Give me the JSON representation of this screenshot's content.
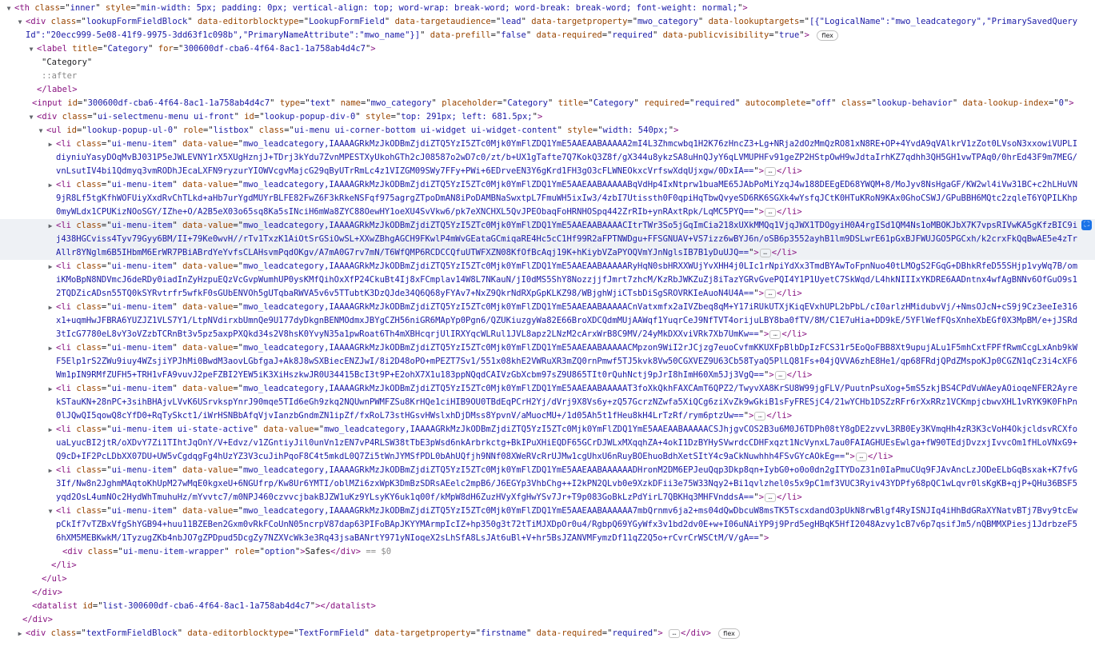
{
  "th_line": {
    "tag": "th",
    "attrs": [
      {
        "name": "class",
        "value": "inner"
      },
      {
        "name": "style",
        "value": "min-width: 5px; padding: 0px; vertical-align: top; word-wrap: break-word; word-break: break-word; font-weight: normal;"
      }
    ]
  },
  "lookup_block": {
    "tag": "div",
    "attrs": [
      {
        "name": "class",
        "value": "lookupFormFieldBlock"
      },
      {
        "name": "data-editorblocktype",
        "value": "LookupFormField"
      },
      {
        "name": "data-targetaudience",
        "value": "lead"
      },
      {
        "name": "data-targetproperty",
        "value": "mwo_category"
      },
      {
        "name": "data-lookuptargets",
        "value": "[{\"LogicalName\":\"mwo_leadcategory\",\"PrimarySavedQueryId\":\"20ecc999-5e08-41f9-9975-3dd63f1c098b\",\"PrimaryNameAttribute\":\"mwo_name\"}]"
      },
      {
        "name": "data-prefill",
        "value": "false"
      },
      {
        "name": "data-required",
        "value": "required"
      },
      {
        "name": "data-publicvisibility",
        "value": "true"
      }
    ],
    "badge": "flex"
  },
  "label_open": {
    "tag": "label",
    "attrs": [
      {
        "name": "title",
        "value": "Category"
      },
      {
        "name": "for",
        "value": "300600df-cba6-4f64-8ac1-1a758ab4d4c7"
      }
    ]
  },
  "label_text": "\"Category\"",
  "label_after": "::after",
  "label_close": "label",
  "input_line": {
    "tag": "input",
    "attrs": [
      {
        "name": "id",
        "value": "300600df-cba6-4f64-8ac1-1a758ab4d4c7"
      },
      {
        "name": "type",
        "value": "text"
      },
      {
        "name": "name",
        "value": "mwo_category"
      },
      {
        "name": "placeholder",
        "value": "Category"
      },
      {
        "name": "title",
        "value": "Category"
      },
      {
        "name": "required",
        "value": "required"
      },
      {
        "name": "autocomplete",
        "value": "off"
      },
      {
        "name": "class",
        "value": "lookup-behavior"
      },
      {
        "name": "data-lookup-index",
        "value": "0"
      }
    ]
  },
  "popup_div": {
    "tag": "div",
    "attrs": [
      {
        "name": "class",
        "value": "ui-selectmenu-menu ui-front"
      },
      {
        "name": "id",
        "value": "lookup-popup-div-0"
      },
      {
        "name": "style",
        "value": "top: 291px; left: 681.5px;"
      }
    ]
  },
  "ul_line": {
    "tag": "ul",
    "attrs": [
      {
        "name": "id",
        "value": "lookup-popup-ul-0"
      },
      {
        "name": "role",
        "value": "listbox"
      },
      {
        "name": "class",
        "value": "ui-menu ui-corner-bottom ui-widget ui-widget-content"
      },
      {
        "name": "style",
        "value": "width: 540px;"
      }
    ]
  },
  "items": [
    {
      "class": "ui-menu-item",
      "value": "mwo_leadcategory,IAAAAGRkMzJkODBmZjdiZTQ5YzI5ZTc0Mjk0YmFlZDQ1YmE5AAEAABAAAAA2mI4L3Zhmcwbq1H2K76zHncZ3+Lg+NRja2dOzMmQzRO81xN8RE+OP+4YvdA9qVAlkrV1zZot0LVsoN3xxowiVUPLIdiyniuYasyDOqMvBJ031P5eJWLEVNY1rX5XUgHznjJ+TDrj3kYdu7ZvnMPESTXyUkohGTh2cJ08587o2wD7c0/zt/b+UX1gTafte7Q7KokQ3Z8f/gX344u8ykzSA8uHnQJyY6qLVMUPHFv91geZP2HStpOwH9wJdtaIrhKZ7qdhh3QH5GH1vwTPAq0/0hrEd43F9m7MEG/vnLsutIV4bi1Qdmyq3vmRODhJEcaLXFN9ryzurYIOWVcgvMajcG29qByUTrRmLc4z1VIZGM09SWy7FFy+PWi+6EDrveEN3Y6gKrd1FH3gO3cFLWNEOkxcVrfswXdqUjxgw/0DxIA=="
    },
    {
      "class": "ui-menu-item",
      "value": "mwo_leadcategory,IAAAAGRkMzJkODBmZjdiZTQ5YzI5ZTc0Mjk0YmFlZDQ1YmE5AAEAABAAAAABqVdHp4IxNtprw1buaME65JAbPoMiYzqJ4w188DEEgED68YWQM+8/MoJyv8NsHgaGF/KW2wl4iVw31BC+c2hLHuVN9jR8Lf5tgKfhWOFUiyXxdRvChTLkd+aHb7urYgdMUYrBLFE82FwZ6F3kRkeNSFqf975agrgZTpoDmAN8iPoDAMBNaSwxtpL7FmuWH5ixIw3/4zbI7Utissth0F0qpiHqTbwQvyeSD6RK6SGXk4wYsfqJCtK0HTuKRoN9KAx0GhoCSWJ/GPuBBH6MQtc2zqleT6YQPILKhp0myWLdx1CPUKizNOoSGY/IZhe+O/A2B5eX03o65sq8Ka5sINciH6mWa8ZYC88OewHY1oeXU4SvVkw6/pk7eXNCHXL5QvJPEObaqFoHRNHOSpq442ZrRIb+ynRAxtRpk/LqMC5PYQ=="
    },
    {
      "class": "ui-menu-item",
      "value": "mwo_leadcategory,IAAAAGRkMzJkODBmZjdiZTQ5YzI5ZTc0Mjk0YmFlZDQ1YmE5AAEAABAAAACItrTWr3So5jGqImCia218xUXkMMQq1VjqJWX1TDOgyiH0A4rgISd1QM4Ns1oMBOKJbX7K7vpsRIVwKA5gKfzBIC9ij438HGCviss4Tyv79Gyy6BM/II+79Ke0wvH//rTv1TxzK1AiOtSrGSiOwSL+XXwZBhgAGCH9FKwlP4mWvGEataGCmiqaRE4Hc5cC1Hf99R2aFPTNWDgu+FFSGNUAV+VS7izz6wBYJ6n/oSB6p3552ayhB1lm9DSLwrE61pGxBJFWUJGO5PGCxh/k2crxFkQqBwAE5e4zTrAllr8YNglm6B5IHbmM6ErWR7PBiABrdYeYvfsCLAHsvmPqdOKgv/A7mA0G7rv7mN/T6WfQMP6RCDCCQfuUTWFXZN08KfOfBcAqj19K+hKiybVZaPYOQVmYJnNglsIB7B1yDuUJQ=="
    },
    {
      "class": "ui-menu-item",
      "value": "mwo_leadcategory,IAAAAGRkMzJkODBmZjdiZTQ5YzI5ZTc0Mjk0YmFlZDQ1YmE5AAEAABAAAAARyHqN0sbHRXXWUjYvXHH4j0LIc1rNpiYdXx3TmdBYAwToFpnNuo40tLMOgS2FGqG+DBhkRfeD55SHjp1vyWq7B/omiKMoBpN8NDVmcJ6deRDy0iadInZyHzpuEQzVcGvpWumhUP0ysKMfQihOxXfP24CkuBt4Ij8xFCmplav14W8L7NKauN/jI0dMS5ShY8NozzjjfJmrt7zhcM/KzRbJWKZuZj8iTazYGRvGvePQI4Y1P1UyetC7SkWqd/L4hkNIIIxYKDRE6AADntnx4wfAgBNNv6OfGuO9s12TQDZicADsn55TQ0kSYRvtrfr5wfkF0sGUbENVOh5gUTqbaRWVA5v6v5TTubtK3DzQJde34Q6Q68yFYAv7+NxZ9QkrNdRXpGpKLKZ98/WBjghWjiCTsbDiSgSROVRKIeAuoN4U4A=="
    },
    {
      "class": "ui-menu-item",
      "value": "mwo_leadcategory,IAAAAGRkMzJkODBmZjdiZTQ5YzI5ZTc0Mjk0YmFlZDQ1YmE5AAEAABAAAAACnVatxmfx2aIVZbeq8qM+Y17iRUkUTXjKiqEVxhUPL2bPbL/cI0arlzHMidubvVj/+NmsOJcN+cS9j9Cz3eeIe316x1+uqmHwJFBRA6YUZJZ1VLS7Y1/LtpNVdirxbUmnQe9U177dyDkgnBENMOdmxJBYgCZH56niGR6MApYp0Pgn6/QZUKiuzgyWa82E66BroXDCQdmMUjAAWqf1YuqrCeJ9NfTVT4orijuLBY8ba0fTV/8M/C1E7uHia+DD9kE/5YFlWefFQsXnheXbEGf0X3MpBM/e+jJSRd3tIcG7780eL8vY3oVZzbTCRnBt3v5pz5axpPXQkd34s2V8hsK0YvyN35a1pwRoat6Th4mXBHcqrjUlIRXYqcWLRul1JVL8apz2LNzM2cArxWrB8C9MV/24yMkDXXviVRk7Xb7UmKw=="
    },
    {
      "class": "ui-menu-item",
      "value": "mwo_leadcategory,IAAAAGRkMzJkODBmZjdiZTQ5YzI5ZTc0Mjk0YmFlZDQ1YmE5AAEAABAAAAACMpzon9WiI2rJCjzg7euoCvfmKKUXFpBlbDpIzFCS31r5EoQoFBB8Xt9upujALu1F5mhCxtFPFfRwmCcgLxAnb9kWF5Elp1rS2ZWu9iuy4WZsjiYPJhMi0BwdM3aovLGbfgaJ+Ak8J8wSXBiecENZJwI/8i2D48oPO+mPEZT7Sv1/551x08khE2VWRuXR3mZQ0rnPmwf5TJ5kvk8Vw50CGXVEZ9U63Cb58TyaQ5PlLQ81Fs+04jQVVA6zhE8He1/qp68FRdjQPdZMspoKJp0CGZN1qCz3i4cXF6Wm1pIN9RMfZUFH5+TRH1vFA9vuvJ2peFZBI2YEW5iK3XiHszkwJR0U34415BcI3t9P+E2ohX7X1u183ppNQqdCAIVzGbXcbm97sZ9U865TIt0rQuhNctj9pJrI8hImH60Xm5Jj3VgQ=="
    },
    {
      "class": "ui-menu-item",
      "value": "mwo_leadcategory,IAAAAGRkMzJkODBmZjdiZTQ5YzI5ZTc0Mjk0YmFlZDQ1YmE5AAEAABAAAAAT3foXkQkhFAXCAmT6QPZ2/TwyvXA8KrSU8W99jgFLV/PuutnPsuXog+5mS5zkjBS4CPdVuWAeyAOioqeNFER2AyrekSTauKN+28nPC+3sihBHAjvLVvK6USrvkspYnrJ90mqe5TId6eGh9zkq2NQUwnPWMFZSu8KrHQe1ciHIB9OU0TBdEqPCrH2Yj/dVrj9X8Vs6y+zQ57GcrzNZwfa5XiQCg6ziXvZk9wGkiB1sFyFRESjC4/21wYCHb1DSZzRFr6rXxRRz1VCKmpjcbwvXHL1vRYK9K0FhPn0lJQwQI5qowQ8cYfD0+RqTySkct1/iWrHSNBbAfqVjvIanzbGndmZN1ipZf/fxRoL73stHGsvHWslxhDjDMss8YpvnV/aMuocMU+/1d05Ah5t1fHeu8kH4LrTzRf/rym6ptzUw=="
    },
    {
      "class": "ui-menu-item ui-state-active",
      "value": "mwo_leadcategory,IAAAAGRkMzJkODBmZjdiZTQ5YzI5ZTc0Mjk0YmFlZDQ1YmE5AAEAABAAAAACSJhjgvCOS2B3u6M0J6TDPh08tY8gDE2zvvL3RB0Ey3KVmqHh4zR3K3cVoH4OkjcldsvRCXfouaLyucBI2jtR/oXDvY7Zi1TIhtJqOnY/V+Edvz/v1ZGntiyJil0unVn1zEN7vP4RLSW38tTbE3pWsd6nkArbrkctg+BkIPuXHiEQDF65GCrDJWLxMXqqhZA+4okI1DzBYHySVwrdcCDHFxqzt1NcVynxL7au0FAIAGHUEsEwlga+fW90TEdjDvzxjIvvcOm1fHLoVNxG9+Q9cD+IF2PcLDbXX07DU+UW5vCgdqgFg4hUzYZ3V3cuJihPqoF8C4t5mkdL0Q7Zi5tWnJYMSfPDL0bAhUQfjh9NNf08XWeRVcRrUJMw1cgUhxU6nRuyBOEhuoBdhXetSItY4c9aCkNuwhhh4FSvGYcAOkEg=="
    },
    {
      "class": "ui-menu-item",
      "value": "mwo_leadcategory,IAAAAGRkMzJkODBmZjdiZTQ5YzI5ZTc0Mjk0YmFlZDQ1YmE5AAEAABAAAAAADHronM2DM6EPJeuQqp3Dkp8qn+IybG0+o0o0dn2gITYDoZ31n0IaPmuCUq9FJAvAncLzJODeELbGqBsxak+K7fvG3If/Nw8n2JghmMAqtoKhUpM27wMqE0kgxeU+6NGUfrp/Kw8Ur6YMTI/oblMZi6zxWpK3DmBzSDRsAEelc2mpB6/J6EGYp3VhbChg++I2kPN2QLvb0e9XzkDFii3e75W33Nqy2+Bi1qvlzhel0s5x9pC1mf3VUC3Ryiv43YDPfy68pQC1wLqvr0lsKgKB+qjP+QHu36BSF5yqd2OsL4umNOc2HydWhTmuhuHz/mYvvtc7/m0NPJ460czvvcjbakBJZW1uKz9YLsyKY6uk1q00f/kMpW8dH6ZuzHVyXfgHwYSv7Jr+T9p083GoBkLzPdYirL7QBKHq3MHFVnddsA=="
    },
    {
      "class": "ui-menu-item",
      "value": "mwo_leadcategory,IAAAAGRkMzJkODBmZjdiZTQ5YzI5ZTc0Mjk0YmFlZDQ1YmE5AAEAABAAAAAA7mbQrnmv6ja2+ms04dQwDbcuW8msTK5TscxdandO3pUkN8rwBlgf4RyISNJIq4iHhBdGRaXYNatvBTj7Bvy9tcEwpCkIf7vTZBxVfgShYGB94+huu11BZEBen2Gxm0vRkFCoUnN05ncrpV87dap63PIFoBApJKYYMArmpIcIZ+hp350g3t72tTiMJXDpOr0u4/RgbpQ69YGyWfx3v1bd2dv0E+w+I06uNAiYP9j9Prd5egHBqK5HfI2048Azvy1cB7v6p7qsifJm5/nQBMMXPiesj1JdrbzeF56hXM5MEBKwkM/1TyzugZKb4nbJO7gZPDpud5DcgZy7NZXVcWk3e3Rq43jsaBANrtY971yNIoqeX2sLhSfA8LsJAt6uBl+V+hr5BsJZANVMFymzDf11qZ2Q5o+rCvrCrWSCtM/V/gA=="
    }
  ],
  "option_wrapper": {
    "class": "ui-menu-item-wrapper",
    "role": "option",
    "text": "Safes",
    "marker": "== $0"
  },
  "close_li": "li",
  "close_ul": "ul",
  "close_div1": "div",
  "close_div2": "div",
  "datalist_line": {
    "tag": "datalist",
    "attrs": [
      {
        "name": "id",
        "value": "list-300600df-cba6-4f64-8ac1-1a758ab4d4c7"
      }
    ]
  },
  "close_div3": "div",
  "text_block": {
    "tag": "div",
    "attrs": [
      {
        "name": "class",
        "value": "textFormFieldBlock"
      },
      {
        "name": "data-editorblocktype",
        "value": "TextFormField"
      },
      {
        "name": "data-targetproperty",
        "value": "firstname"
      },
      {
        "name": "data-required",
        "value": "required"
      }
    ],
    "badge": "flex"
  },
  "colors": {
    "tag": "#881280",
    "attr_name": "#994500",
    "attr_value": "#1a1aa6",
    "hover_row": "#eef1f5"
  },
  "icons": {
    "expand": "triangle-right-icon",
    "collapse": "triangle-down-icon",
    "ellipsis": "ellipsis-icon",
    "picker": "element-picker-icon"
  }
}
